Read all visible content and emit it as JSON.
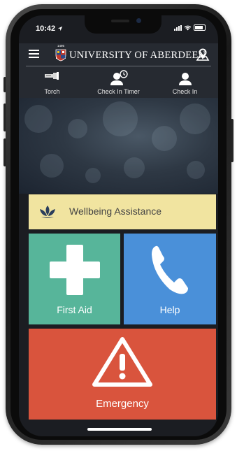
{
  "status_bar": {
    "time": "10:42",
    "location_icon": "location-arrow-icon",
    "signal_icon": "signal-icon",
    "wifi_icon": "wifi-icon",
    "battery_icon": "battery-icon"
  },
  "header": {
    "title": "UNIVERSITY OF ABERDEEN",
    "crest_text": "1495",
    "menu_icon": "hamburger-menu-icon",
    "map_icon": "map-pin-icon"
  },
  "toolbar": {
    "items": [
      {
        "label": "Torch",
        "icon": "torch-icon"
      },
      {
        "label": "Check In Timer",
        "icon": "user-clock-icon"
      },
      {
        "label": "Check In",
        "icon": "user-icon"
      }
    ]
  },
  "tiles": {
    "wellbeing": {
      "label": "Wellbeing Assistance",
      "icon": "lotus-icon",
      "color": "#f1e4a0"
    },
    "first_aid": {
      "label": "First Aid",
      "icon": "plus-cross-icon",
      "color": "#57b59a"
    },
    "help": {
      "label": "Help",
      "icon": "phone-icon",
      "color": "#4a90d9"
    },
    "emergency": {
      "label": "Emergency",
      "icon": "warning-triangle-icon",
      "color": "#d9543d"
    }
  },
  "colors": {
    "header_bg": "#262a31",
    "lotus": "#2b3e5c"
  }
}
